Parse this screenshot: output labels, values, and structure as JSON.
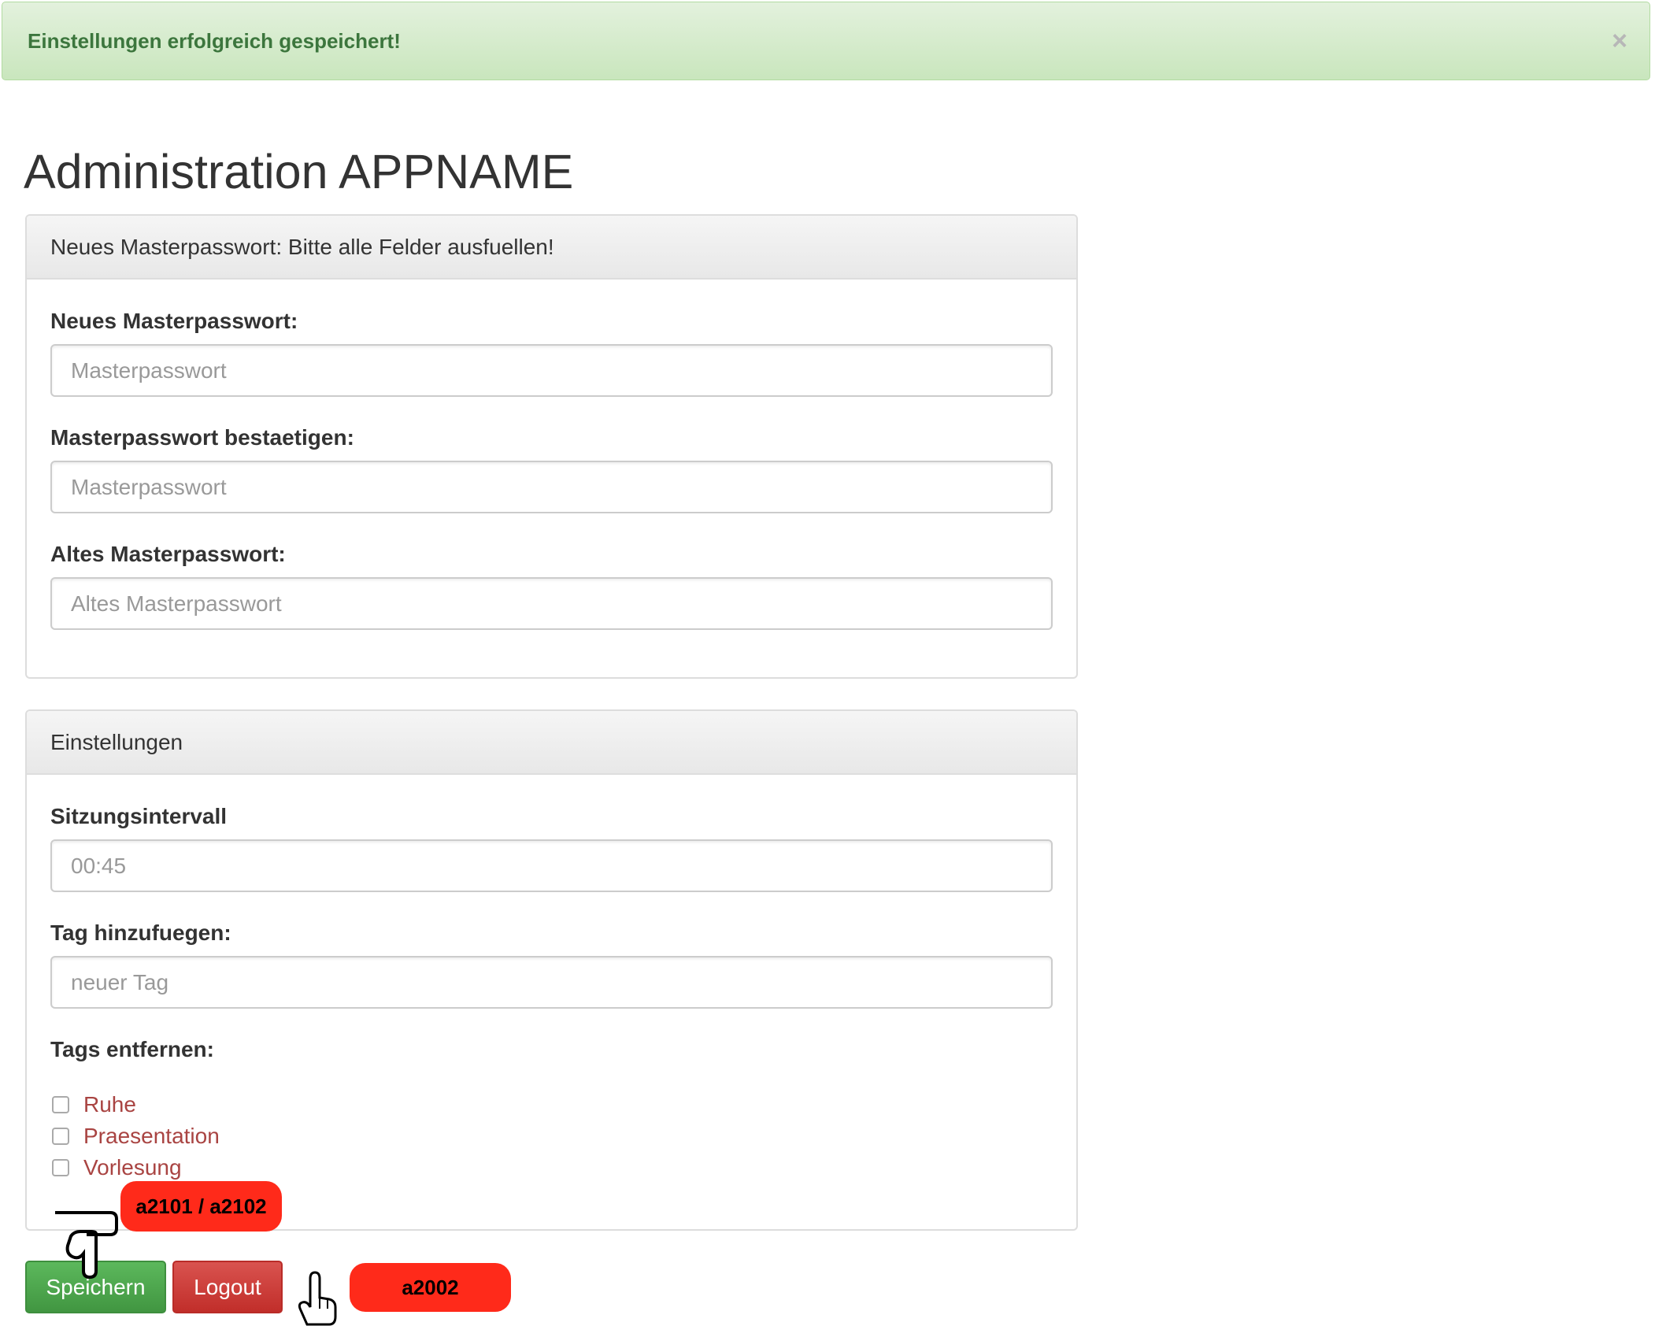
{
  "alert": {
    "message": "Einstellungen erfolgreich gespeichert!",
    "close_symbol": "×"
  },
  "page_title": "Administration APPNAME",
  "password_panel": {
    "heading": "Neues Masterpasswort: Bitte alle Felder ausfuellen!",
    "fields": [
      {
        "label": "Neues Masterpasswort:",
        "placeholder": "Masterpasswort",
        "value": ""
      },
      {
        "label": "Masterpasswort bestaetigen:",
        "placeholder": "Masterpasswort",
        "value": ""
      },
      {
        "label": "Altes Masterpasswort:",
        "placeholder": "Altes Masterpasswort",
        "value": ""
      }
    ]
  },
  "settings_panel": {
    "heading": "Einstellungen",
    "interval_label": "Sitzungsintervall",
    "interval_placeholder": "00:45",
    "add_tag_label": "Tag hinzufuegen:",
    "add_tag_placeholder": "neuer Tag",
    "remove_tags_label": "Tags entfernen:",
    "tags": [
      "Ruhe",
      "Praesentation",
      "Vorlesung"
    ]
  },
  "buttons": {
    "save": "Speichern",
    "logout": "Logout"
  },
  "annotations": {
    "save_badge": "a2101 / a2102",
    "logout_badge": "a2002",
    "badge_color": "#ff2a1a"
  },
  "colors": {
    "alert_text": "#3c763d",
    "tag_text": "#a94442",
    "save_button": "#5cb85c",
    "logout_button": "#d9534f"
  },
  "icons": [
    "close-icon",
    "hand-pointer-icon"
  ]
}
